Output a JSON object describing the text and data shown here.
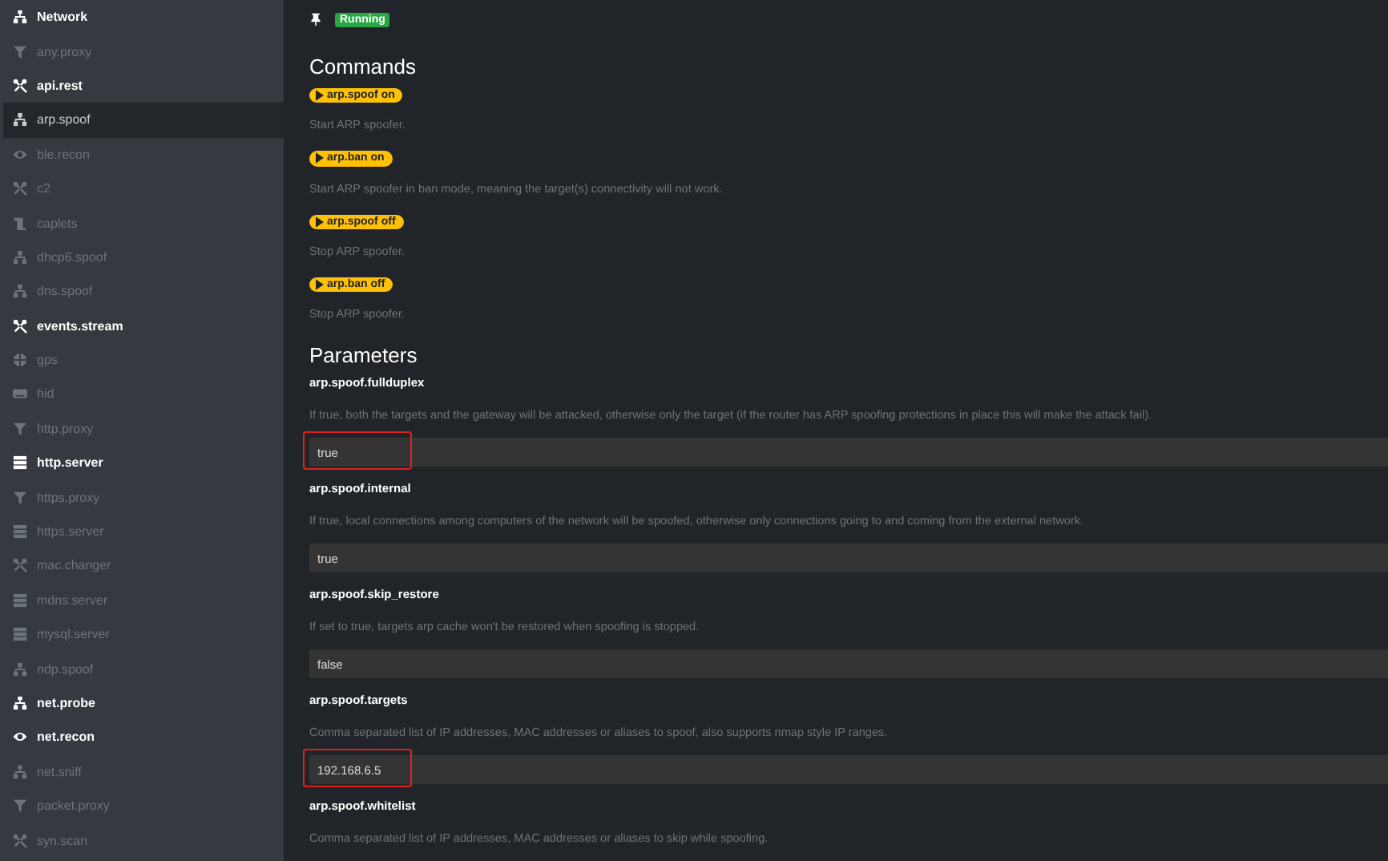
{
  "sidebar": {
    "items": [
      {
        "label": "Network",
        "kind": "network",
        "running": true,
        "selected": false
      },
      {
        "label": "any.proxy",
        "kind": "filter",
        "running": false,
        "selected": false
      },
      {
        "label": "api.rest",
        "kind": "tools",
        "running": true,
        "selected": false
      },
      {
        "label": "arp.spoof",
        "kind": "sitemap",
        "running": false,
        "selected": true
      },
      {
        "label": "ble.recon",
        "kind": "eye",
        "running": false,
        "selected": false
      },
      {
        "label": "c2",
        "kind": "tools",
        "running": false,
        "selected": false
      },
      {
        "label": "caplets",
        "kind": "scroll",
        "running": false,
        "selected": false
      },
      {
        "label": "dhcp6.spoof",
        "kind": "sitemap",
        "running": false,
        "selected": false
      },
      {
        "label": "dns.spoof",
        "kind": "sitemap",
        "running": false,
        "selected": false
      },
      {
        "label": "events.stream",
        "kind": "tools",
        "running": true,
        "selected": false
      },
      {
        "label": "gps",
        "kind": "globe",
        "running": false,
        "selected": false
      },
      {
        "label": "hid",
        "kind": "keyboard",
        "running": false,
        "selected": false
      },
      {
        "label": "http.proxy",
        "kind": "filter",
        "running": false,
        "selected": false
      },
      {
        "label": "http.server",
        "kind": "server",
        "running": true,
        "selected": false
      },
      {
        "label": "https.proxy",
        "kind": "filter",
        "running": false,
        "selected": false
      },
      {
        "label": "https.server",
        "kind": "server",
        "running": false,
        "selected": false
      },
      {
        "label": "mac.changer",
        "kind": "tools",
        "running": false,
        "selected": false
      },
      {
        "label": "mdns.server",
        "kind": "server",
        "running": false,
        "selected": false
      },
      {
        "label": "mysql.server",
        "kind": "server",
        "running": false,
        "selected": false
      },
      {
        "label": "ndp.spoof",
        "kind": "sitemap",
        "running": false,
        "selected": false
      },
      {
        "label": "net.probe",
        "kind": "network",
        "running": true,
        "selected": false
      },
      {
        "label": "net.recon",
        "kind": "eye",
        "running": true,
        "selected": false
      },
      {
        "label": "net.sniff",
        "kind": "network",
        "running": false,
        "selected": false
      },
      {
        "label": "packet.proxy",
        "kind": "filter",
        "running": false,
        "selected": false
      },
      {
        "label": "syn.scan",
        "kind": "tools",
        "running": false,
        "selected": false
      }
    ]
  },
  "status": {
    "label": "Running",
    "running": true
  },
  "commands": {
    "title": "Commands",
    "items": [
      {
        "label": "arp.spoof on",
        "description": "Start ARP spoofer."
      },
      {
        "label": "arp.ban on",
        "description": "Start ARP spoofer in ban mode, meaning the target(s) connectivity will not work."
      },
      {
        "label": "arp.spoof off",
        "description": "Stop ARP spoofer."
      },
      {
        "label": "arp.ban off",
        "description": "Stop ARP spoofer."
      }
    ]
  },
  "parameters": {
    "title": "Parameters",
    "items": [
      {
        "name": "arp.spoof.fullduplex",
        "description": "If true, both the targets and the gateway will be attacked, otherwise only the target (if the router has ARP spoofing protections in place this will make the attack fail).",
        "value": "true",
        "highlighted": true
      },
      {
        "name": "arp.spoof.internal",
        "description": "If true, local connections among computers of the network will be spoofed, otherwise only connections going to and coming from the external network.",
        "value": "true",
        "highlighted": false
      },
      {
        "name": "arp.spoof.skip_restore",
        "description": "If set to true, targets arp cache won't be restored when spoofing is stopped.",
        "value": "false",
        "highlighted": false
      },
      {
        "name": "arp.spoof.targets",
        "description": "Comma separated list of IP addresses, MAC addresses or aliases to spoof, also supports nmap style IP ranges.",
        "value": "192.168.6.5",
        "highlighted": true
      },
      {
        "name": "arp.spoof.whitelist",
        "description": "Comma separated list of IP addresses, MAC addresses or aliases to skip while spoofing."
      }
    ]
  }
}
